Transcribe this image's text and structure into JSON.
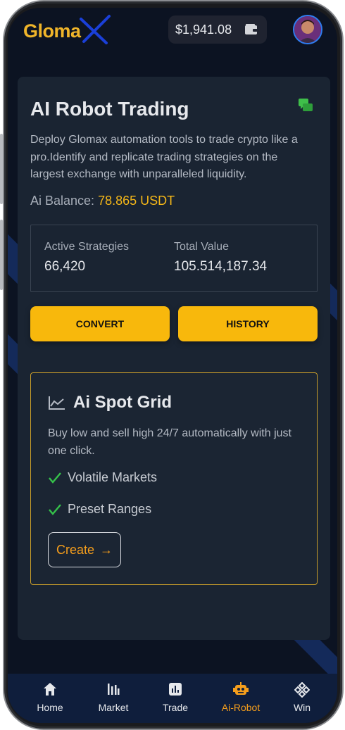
{
  "wallet": {
    "amount": "$1,941.08",
    "icon": "wallet-icon"
  },
  "header": {
    "logo_text": "Gloma",
    "logo_mark": "X"
  },
  "hero": {
    "title": "AI Robot Trading",
    "description": "Deploy Glomax automation tools to trade crypto like a pro.Identify and replicate trading strategies on the largest exchange with unparalleled liquidity.",
    "balance_label": "Ai Balance:",
    "balance_value": "78.865 USDT"
  },
  "stats": [
    {
      "label": "Active Strategies",
      "value": "66,420"
    },
    {
      "label": "Total Value",
      "value": "105.514,187.34"
    }
  ],
  "actions": {
    "convert": "CONVERT",
    "history": "HISTORY"
  },
  "spot_grid": {
    "title": "Ai Spot Grid",
    "description": "Buy low and sell high 24/7 automatically with just one click.",
    "features": [
      "Volatile Markets",
      "Preset Ranges"
    ],
    "create_label": "Create",
    "create_arrow": "→"
  },
  "nav": [
    {
      "label": "Home",
      "icon": "home-icon"
    },
    {
      "label": "Market",
      "icon": "market-icon"
    },
    {
      "label": "Trade",
      "icon": "trade-icon"
    },
    {
      "label": "Ai-Robot",
      "icon": "robot-icon",
      "active": true
    },
    {
      "label": "Win",
      "icon": "gamepad-icon"
    }
  ],
  "colors": {
    "accent": "#f8b80c",
    "active_nav": "#f59e1c",
    "background": "#0c1322",
    "card": "#1a2432"
  }
}
